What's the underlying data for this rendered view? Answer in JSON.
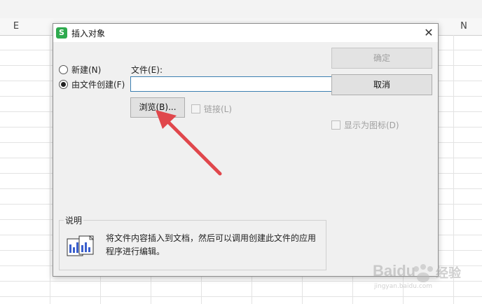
{
  "sheet": {
    "col_e": "E",
    "col_n": "N"
  },
  "dialog": {
    "title": "插入对象",
    "close_glyph": "✕",
    "radio_new": "新建(N)",
    "radio_from_file": "由文件创建(F)",
    "file_label": "文件(E):",
    "file_value": "",
    "browse_label": "浏览(B)...",
    "link_label": "链接(L)",
    "ok_label": "确定",
    "cancel_label": "取消",
    "show_icon_label": "显示为图标(D)",
    "desc_title": "说明",
    "desc_text": "将文件内容插入到文档，然后可以调用创建此文件的应用程序进行编辑。"
  },
  "watermark": {
    "brand": "Baidu",
    "brand_cn": "经验",
    "url": "jingyan.baidu.com"
  },
  "colors": {
    "annotation_arrow": "#e0474c",
    "app_icon": "#2eaa4e",
    "input_border": "#3c7fb1"
  }
}
